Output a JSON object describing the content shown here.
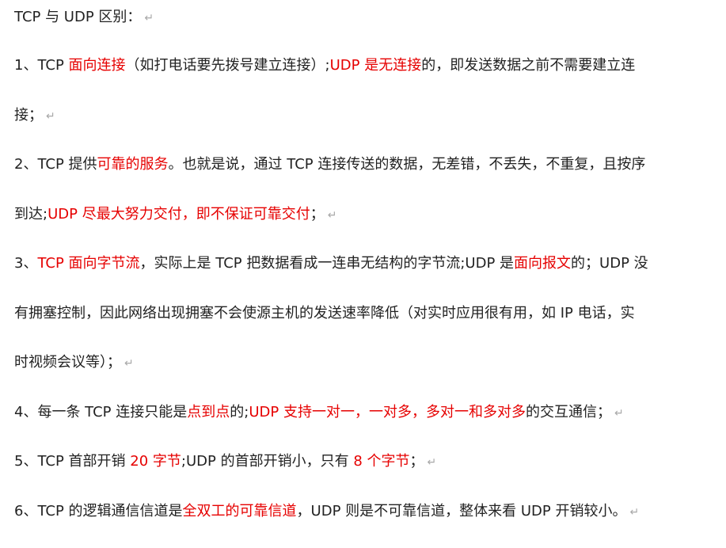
{
  "colors": {
    "text": "#222222",
    "highlight": "#e60000",
    "paragraph_mark": "#a8a8a8"
  },
  "paragraph_mark": "↵",
  "lines": [
    {
      "segments": [
        {
          "text": "TCP 与 UDP 区别：",
          "red": false
        }
      ],
      "pm": true
    },
    {
      "segments": [
        {
          "text": "1、TCP ",
          "red": false
        },
        {
          "text": "面向连接",
          "red": true
        },
        {
          "text": "（如打电话要先拨号建立连接）;",
          "red": false
        },
        {
          "text": "UDP 是无连接",
          "red": true
        },
        {
          "text": "的，即发送数据之前不需要建立连",
          "red": false
        }
      ],
      "pm": false
    },
    {
      "segments": [
        {
          "text": "接；",
          "red": false
        }
      ],
      "pm": true
    },
    {
      "segments": [
        {
          "text": "2、TCP 提供",
          "red": false
        },
        {
          "text": "可靠的服务",
          "red": true
        },
        {
          "text": "。也就是说，通过 TCP 连接传送的数据，无差错，不丢失，不重复，且按序",
          "red": false
        }
      ],
      "pm": false
    },
    {
      "segments": [
        {
          "text": "到达;",
          "red": false
        },
        {
          "text": "UDP 尽最大努力交付，即不保证可靠交付",
          "red": true
        },
        {
          "text": "；",
          "red": false
        }
      ],
      "pm": true
    },
    {
      "segments": [
        {
          "text": "3、",
          "red": false
        },
        {
          "text": "TCP 面向字节流",
          "red": true
        },
        {
          "text": "，实际上是 TCP 把数据看成一连串无结构的字节流;UDP 是",
          "red": false
        },
        {
          "text": "面向报文",
          "red": true
        },
        {
          "text": "的；UDP 没",
          "red": false
        }
      ],
      "pm": false
    },
    {
      "segments": [
        {
          "text": "有拥塞控制，因此网络出现拥塞不会使源主机的发送速率降低（对实时应用很有用，如 IP 电话，实",
          "red": false
        }
      ],
      "pm": false
    },
    {
      "segments": [
        {
          "text": "时视频会议等）；",
          "red": false
        }
      ],
      "pm": true
    },
    {
      "segments": [
        {
          "text": "4、每一条 TCP 连接只能是",
          "red": false
        },
        {
          "text": "点到点",
          "red": true
        },
        {
          "text": "的;",
          "red": false
        },
        {
          "text": "UDP 支持一对一，一对多，多对一和多对多",
          "red": true
        },
        {
          "text": "的交互通信；",
          "red": false
        }
      ],
      "pm": true
    },
    {
      "segments": [
        {
          "text": "5、TCP 首部开销 ",
          "red": false
        },
        {
          "text": "20 字节",
          "red": true
        },
        {
          "text": ";UDP 的首部开销小，只有 ",
          "red": false
        },
        {
          "text": "8 个字节",
          "red": true
        },
        {
          "text": "；",
          "red": false
        }
      ],
      "pm": true
    },
    {
      "segments": [
        {
          "text": "6、TCP 的逻辑通信信道是",
          "red": false
        },
        {
          "text": "全双工的可靠信道",
          "red": true
        },
        {
          "text": "，UDP 则是不可靠信道，整体来看 UDP 开销较小。",
          "red": false
        }
      ],
      "pm": true
    }
  ]
}
